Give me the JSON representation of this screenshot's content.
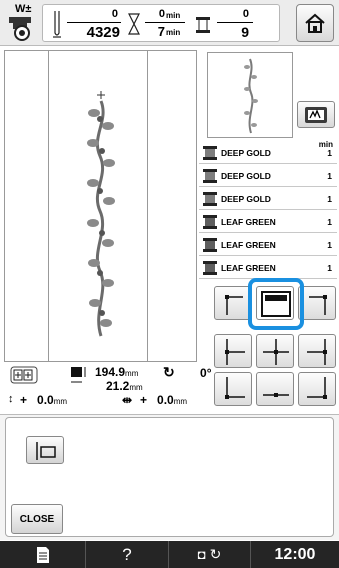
{
  "header": {
    "presser_foot_label": "W±",
    "stitches_done": "0",
    "stitches_total": "4329",
    "time_done": "0",
    "time_total": "7",
    "time_unit": "min",
    "colors_done": "0",
    "colors_total": "9",
    "home_icon": "home-icon"
  },
  "threads": {
    "column_header": "min",
    "items": [
      {
        "name": "DEEP GOLD",
        "minutes": "1",
        "color": "#7d7d7d"
      },
      {
        "name": "DEEP GOLD",
        "minutes": "1",
        "color": "#7d7d7d"
      },
      {
        "name": "DEEP GOLD",
        "minutes": "1",
        "color": "#7d7d7d"
      },
      {
        "name": "LEAF GREEN",
        "minutes": "1",
        "color": "#5e5e5e"
      },
      {
        "name": "LEAF GREEN",
        "minutes": "1",
        "color": "#5e5e5e"
      },
      {
        "name": "LEAF GREEN",
        "minutes": "1",
        "color": "#5e5e5e"
      }
    ]
  },
  "position_grid": {
    "selected": "top-center",
    "options": [
      "top-left",
      "top-center",
      "top-right",
      "middle-left",
      "center",
      "middle-right",
      "bottom-left",
      "bottom-center",
      "bottom-right"
    ]
  },
  "info": {
    "height_value": "194.9",
    "width_value": "21.2",
    "size_unit": "mm",
    "rotation_value": "0",
    "rotation_unit": "°",
    "vertical_offset": "0.0",
    "horizontal_offset": "0.0",
    "offset_unit": "mm",
    "plus_sign": "+"
  },
  "lower": {
    "close_label": "CLOSE"
  },
  "status": {
    "clock": "12:00",
    "help_label": "?",
    "accent": "#1a90e0"
  }
}
